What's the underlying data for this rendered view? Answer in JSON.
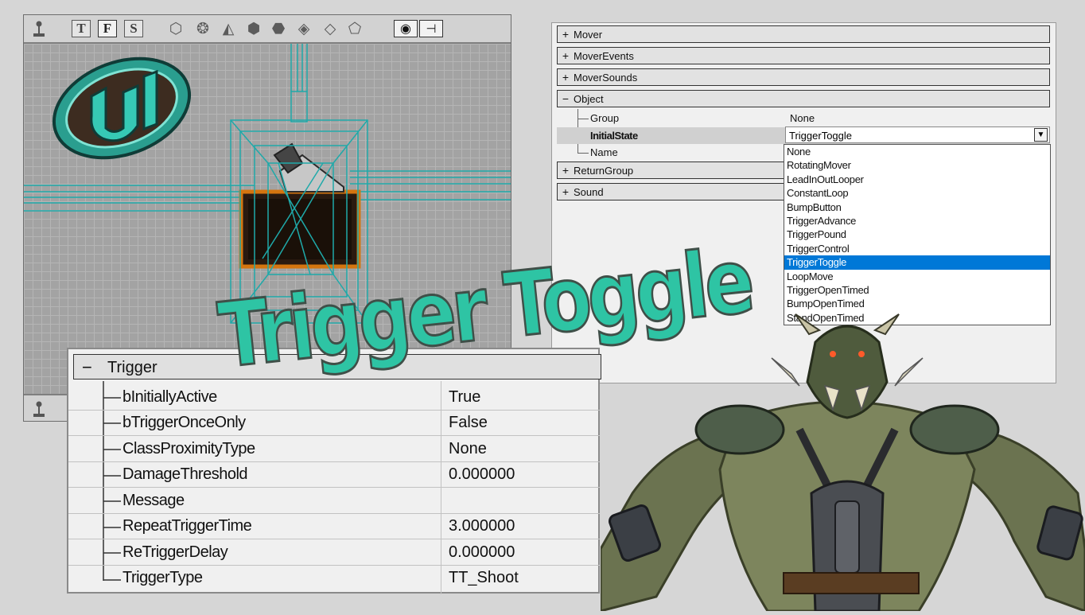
{
  "title_overlay": "Trigger Toggle",
  "viewport": {
    "toolbar_letters": [
      "T",
      "F",
      "S"
    ],
    "active_letter": "F",
    "toolbar_icons": [
      "joystick-icon",
      "cube-icon",
      "sphere-icon",
      "ramp-icon",
      "cylinder-icon",
      "cone-icon",
      "stairs-icon",
      "sheet-icon",
      "volume-icon",
      "eye-icon",
      "pin-icon"
    ],
    "grid_color": "#a3a3a3",
    "wire_color": "#1fa9a9"
  },
  "properties": {
    "categories_top": [
      {
        "sign": "+",
        "label": "Mover"
      },
      {
        "sign": "+",
        "label": "MoverEvents"
      },
      {
        "sign": "+",
        "label": "MoverSounds"
      },
      {
        "sign": "−",
        "label": "Object"
      }
    ],
    "object_rows": [
      {
        "name": "Group",
        "value": "None"
      },
      {
        "name": "InitialState",
        "value": "TriggerToggle"
      },
      {
        "name": "Name",
        "value": ""
      }
    ],
    "categories_bottom": [
      {
        "sign": "+",
        "label": "ReturnGroup"
      },
      {
        "sign": "+",
        "label": "Sound"
      }
    ],
    "combo_value": "TriggerToggle",
    "dropdown_options": [
      "None",
      "RotatingMover",
      "LeadInOutLooper",
      "ConstantLoop",
      "BumpButton",
      "TriggerAdvance",
      "TriggerPound",
      "TriggerControl",
      "TriggerToggle",
      "LoopMove",
      "TriggerOpenTimed",
      "BumpOpenTimed",
      "StandOpenTimed"
    ],
    "highlight_color": "#0078d7"
  },
  "trigger": {
    "sign": "−",
    "header": "Trigger",
    "rows": [
      {
        "name": "bInitiallyActive",
        "value": "True"
      },
      {
        "name": "bTriggerOnceOnly",
        "value": "False"
      },
      {
        "name": "ClassProximityType",
        "value": "None"
      },
      {
        "name": "DamageThreshold",
        "value": "0.000000"
      },
      {
        "name": "Message",
        "value": ""
      },
      {
        "name": "RepeatTriggerTime",
        "value": "3.000000"
      },
      {
        "name": "ReTriggerDelay",
        "value": "0.000000"
      },
      {
        "name": "TriggerType",
        "value": "TT_Shoot"
      }
    ]
  },
  "colors": {
    "title_fill": "#2ec4a4",
    "logo_teal": "#36c9b5"
  }
}
